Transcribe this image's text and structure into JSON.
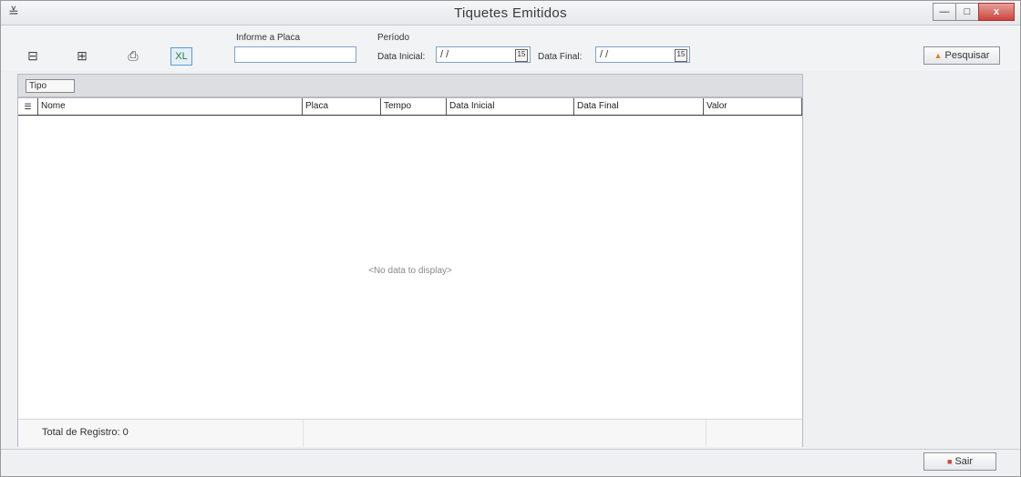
{
  "window": {
    "title": "Tiquetes Emitidos",
    "app_icon": "app-icon",
    "controls": {
      "minimize": "—",
      "maximize": "□",
      "close": "x"
    }
  },
  "toolbar": {
    "icons": [
      "database-icon",
      "tree-icon",
      "print-icon",
      "excel-icon"
    ],
    "placa_label": "Informe a Placa",
    "placa_value": "",
    "periodo_label": "Período",
    "data_inicial_label": "Data Inicial:",
    "data_inicial_value": "/ /",
    "data_final_label": "Data Final:",
    "data_final_value": "/ /",
    "pesquisar_label": "Pesquisar"
  },
  "group_panel": {
    "chip_label": "Tipo"
  },
  "grid": {
    "columns": [
      "Nome",
      "Placa",
      "Tempo",
      "Data Inicial",
      "Data Final",
      "Valor"
    ],
    "rows": [],
    "empty_text": "<No data to display>",
    "footer_total": "Total de Registro: 0"
  },
  "actions": {
    "sair_label": "Sair"
  },
  "colors": {
    "accent": "#5a9bd5",
    "close_button": "#c9463d"
  }
}
